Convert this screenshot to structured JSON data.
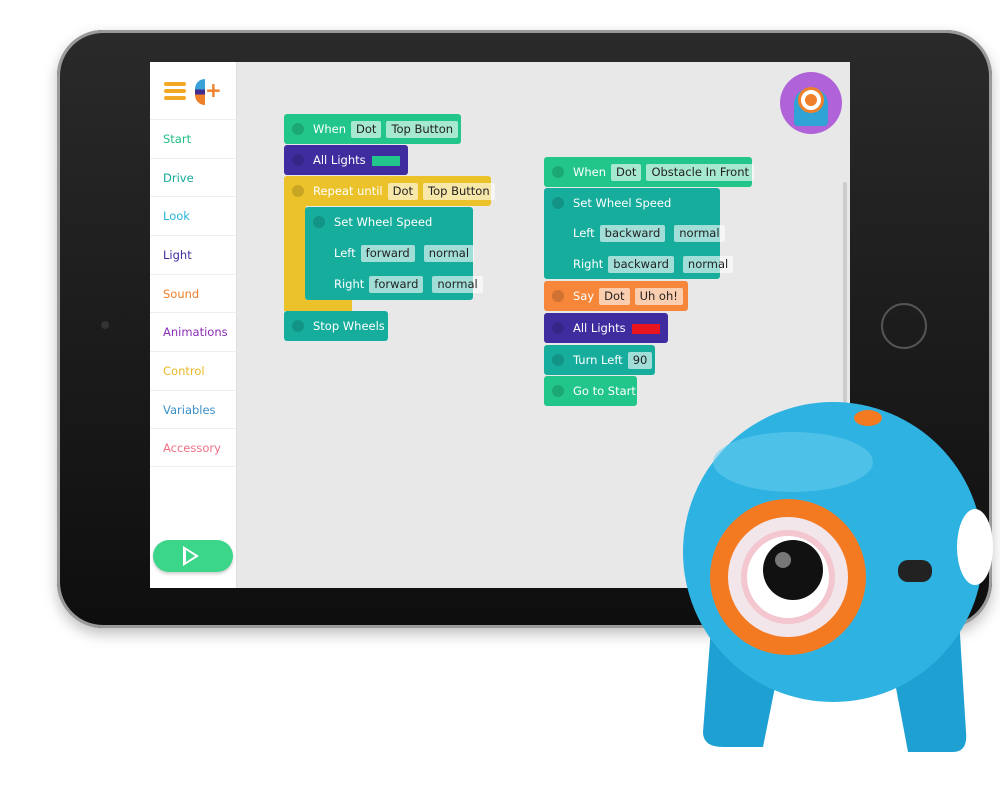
{
  "sidebar": {
    "items": [
      {
        "label": "Start",
        "color": "#1fbf83"
      },
      {
        "label": "Drive",
        "color": "#14a99a"
      },
      {
        "label": "Look",
        "color": "#2cb3d9"
      },
      {
        "label": "Light",
        "color": "#3f2d9f"
      },
      {
        "label": "Sound",
        "color": "#f07f2a"
      },
      {
        "label": "Animations",
        "color": "#8a2db5"
      },
      {
        "label": "Control",
        "color": "#e9b824"
      },
      {
        "label": "Variables",
        "color": "#3a8fc6"
      },
      {
        "label": "Accessory",
        "color": "#f06f86"
      }
    ]
  },
  "program1": {
    "when": {
      "label": "When",
      "robot": "Dot",
      "event": "Top Button"
    },
    "lights": {
      "label": "All Lights",
      "color": "#22c68a"
    },
    "repeat": {
      "label": "Repeat until",
      "robot": "Dot",
      "event": "Top Button"
    },
    "wheels": {
      "label": "Set Wheel Speed",
      "left": "Left",
      "left_dir": "forward",
      "left_speed": "normal",
      "right": "Right",
      "right_dir": "forward",
      "right_speed": "normal"
    },
    "stop": {
      "label": "Stop Wheels"
    }
  },
  "program2": {
    "when": {
      "label": "When",
      "robot": "Dot",
      "event": "Obstacle In Front"
    },
    "wheels": {
      "label": "Set Wheel Speed",
      "left": "Left",
      "left_dir": "backward",
      "left_speed": "normal",
      "right": "Right",
      "right_dir": "backward",
      "right_speed": "normal"
    },
    "say": {
      "label": "Say",
      "robot": "Dot",
      "phrase": "Uh oh!"
    },
    "lights": {
      "label": "All Lights",
      "color": "#e8141e"
    },
    "turn": {
      "label": "Turn Left",
      "value": "90"
    },
    "goto": {
      "label": "Go to Start"
    }
  }
}
